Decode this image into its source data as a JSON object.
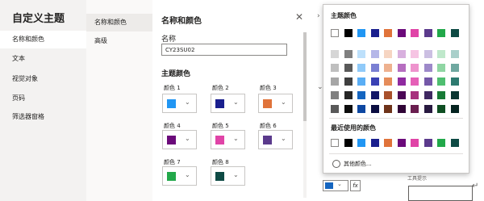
{
  "nav": {
    "title": "自定义主题",
    "items": [
      "名称和颜色",
      "文本",
      "视觉对象",
      "页码",
      "筛选器窗格"
    ]
  },
  "subnav": {
    "items": [
      "名称和颜色",
      "高级"
    ]
  },
  "main": {
    "title": "名称和颜色",
    "name_label": "名称",
    "name_value": "CY23SU02",
    "colors_heading": "主题颜色",
    "color_items": [
      {
        "label": "颜色 1",
        "color": "#2196f3"
      },
      {
        "label": "颜色 2",
        "color": "#1a1f8e"
      },
      {
        "label": "颜色 3",
        "color": "#e0733a"
      },
      {
        "label": "颜色 4",
        "color": "#6b0a7a"
      },
      {
        "label": "颜色 5",
        "color": "#e044a7"
      },
      {
        "label": "颜色 6",
        "color": "#5b3a8c"
      },
      {
        "label": "颜色 7",
        "color": "#22a84a"
      },
      {
        "label": "颜色 8",
        "color": "#0e4a44"
      }
    ],
    "close_icon": "close-icon"
  },
  "popup": {
    "theme_heading": "主题颜色",
    "recent_heading": "最近使用的颜色",
    "more_colors": "其他颜色...",
    "theme_grid": [
      [
        "#ffffff",
        "#000000",
        "#2196f3",
        "#1a1f8e",
        "#e0733a",
        "#6b0a7a",
        "#e044a7",
        "#5b3a8c",
        "#22a84a",
        "#0e4a44"
      ],
      [
        "#d6d6d6",
        "#7f7f7f",
        "#bde0fb",
        "#b5b7e8",
        "#f6d5c2",
        "#d8b0de",
        "#f6c4e3",
        "#cbbfe2",
        "#bfe8cb",
        "#a9cfca"
      ],
      [
        "#bfbfbf",
        "#595959",
        "#90caf9",
        "#7a7fd3",
        "#eeb18f",
        "#b66ec0",
        "#ee93cd",
        "#9d89c9",
        "#8fd6a3",
        "#6fa8a0"
      ],
      [
        "#a6a6a6",
        "#3f3f3f",
        "#5aaef5",
        "#3a41b4",
        "#e58c5a",
        "#8f2aa0",
        "#e560b7",
        "#7458a8",
        "#4fbe70",
        "#2d7a70"
      ],
      [
        "#808080",
        "#262626",
        "#1565c0",
        "#121566",
        "#a8502b",
        "#4b0756",
        "#a7307d",
        "#3f2862",
        "#187a36",
        "#093530"
      ],
      [
        "#595959",
        "#0d0d0d",
        "#0d47a1",
        "#0b0d40",
        "#6e3319",
        "#300436",
        "#6a1e4f",
        "#281940",
        "#0f4e22",
        "#052320"
      ]
    ],
    "recent": [
      "#ffffff",
      "#000000",
      "#2196f3",
      "#1a1f8e",
      "#e0733a",
      "#6b0a7a",
      "#e044a7",
      "#5b3a8c",
      "#22a84a",
      "#0e4a44"
    ]
  },
  "bottom": {
    "fx_label": "fx",
    "tip_label": "工具提示",
    "picker_color": "#1565c0"
  }
}
